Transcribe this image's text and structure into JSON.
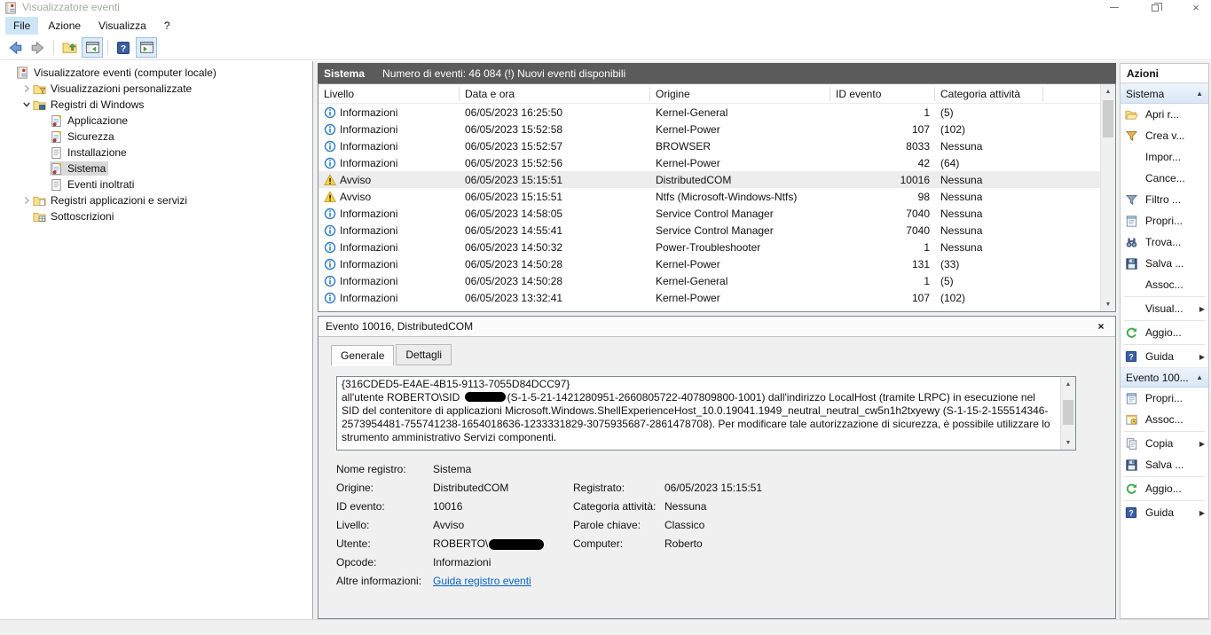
{
  "window": {
    "title": "Visualizzatore eventi"
  },
  "menu": {
    "items": [
      {
        "label": "File",
        "highlighted": true
      },
      {
        "label": "Azione",
        "highlighted": false
      },
      {
        "label": "Visualizza",
        "highlighted": false
      },
      {
        "label": "?",
        "highlighted": false
      }
    ]
  },
  "toolbar": {
    "buttons": [
      {
        "name": "back-button",
        "icon": "back-arrow",
        "toggled": false
      },
      {
        "name": "forward-button",
        "icon": "forward-arrow",
        "toggled": false
      },
      {
        "sep": true
      },
      {
        "name": "open-saved-log-button",
        "icon": "open-saved-log",
        "toggled": false
      },
      {
        "name": "show-console-tree-button",
        "icon": "console-tree-toggle",
        "toggled": true
      },
      {
        "sep": true
      },
      {
        "name": "help-button",
        "icon": "help-toolbar",
        "toggled": false
      },
      {
        "name": "show-action-pane-button",
        "icon": "action-pane-toggle",
        "toggled": true
      }
    ]
  },
  "tree": {
    "items": [
      {
        "label": "Visualizzatore eventi (computer locale)",
        "icon": "event-viewer",
        "indent": 0,
        "expander": "none",
        "selected": false
      },
      {
        "label": "Visualizzazioni personalizzate",
        "icon": "folder-filter",
        "indent": 1,
        "expander": "collapsed",
        "selected": false
      },
      {
        "label": "Registri di Windows",
        "icon": "folder-log",
        "indent": 1,
        "expander": "expanded",
        "selected": false
      },
      {
        "label": "Applicazione",
        "icon": "log",
        "indent": 2,
        "expander": "none",
        "selected": false
      },
      {
        "label": "Sicurezza",
        "icon": "log",
        "indent": 2,
        "expander": "none",
        "selected": false
      },
      {
        "label": "Installazione",
        "icon": "log-plain",
        "indent": 2,
        "expander": "none",
        "selected": false
      },
      {
        "label": "Sistema",
        "icon": "log",
        "indent": 2,
        "expander": "none",
        "selected": true
      },
      {
        "label": "Eventi inoltrati",
        "icon": "log-plain",
        "indent": 2,
        "expander": "none",
        "selected": false
      },
      {
        "label": "Registri applicazioni e servizi",
        "icon": "folder-apps",
        "indent": 1,
        "expander": "collapsed",
        "selected": false
      },
      {
        "label": "Sottoscrizioni",
        "icon": "folder-table",
        "indent": 1,
        "expander": "none",
        "selected": false
      }
    ]
  },
  "main": {
    "header": {
      "title": "Sistema",
      "subtitle": "Numero di eventi: 46 084 (!) Nuovi eventi disponibili"
    },
    "table": {
      "columns": [
        "Livello",
        "Data e ora",
        "Origine",
        "ID evento",
        "Categoria attività"
      ],
      "rows": [
        {
          "level": "Informazioni",
          "level_icon": "info",
          "datetime": "06/05/2023 16:25:50",
          "source": "Kernel-General",
          "event_id": "1",
          "category": "(5)",
          "selected": false
        },
        {
          "level": "Informazioni",
          "level_icon": "info",
          "datetime": "06/05/2023 15:52:58",
          "source": "Kernel-Power",
          "event_id": "107",
          "category": "(102)",
          "selected": false
        },
        {
          "level": "Informazioni",
          "level_icon": "info",
          "datetime": "06/05/2023 15:52:57",
          "source": "BROWSER",
          "event_id": "8033",
          "category": "Nessuna",
          "selected": false
        },
        {
          "level": "Informazioni",
          "level_icon": "info",
          "datetime": "06/05/2023 15:52:56",
          "source": "Kernel-Power",
          "event_id": "42",
          "category": "(64)",
          "selected": false
        },
        {
          "level": "Avviso",
          "level_icon": "warning",
          "datetime": "06/05/2023 15:15:51",
          "source": "DistributedCOM",
          "event_id": "10016",
          "category": "Nessuna",
          "selected": true
        },
        {
          "level": "Avviso",
          "level_icon": "warning",
          "datetime": "06/05/2023 15:15:51",
          "source": "Ntfs (Microsoft-Windows-Ntfs)",
          "event_id": "98",
          "category": "Nessuna",
          "selected": false
        },
        {
          "level": "Informazioni",
          "level_icon": "info",
          "datetime": "06/05/2023 14:58:05",
          "source": "Service Control Manager",
          "event_id": "7040",
          "category": "Nessuna",
          "selected": false
        },
        {
          "level": "Informazioni",
          "level_icon": "info",
          "datetime": "06/05/2023 14:55:41",
          "source": "Service Control Manager",
          "event_id": "7040",
          "category": "Nessuna",
          "selected": false
        },
        {
          "level": "Informazioni",
          "level_icon": "info",
          "datetime": "06/05/2023 14:50:32",
          "source": "Power-Troubleshooter",
          "event_id": "1",
          "category": "Nessuna",
          "selected": false
        },
        {
          "level": "Informazioni",
          "level_icon": "info",
          "datetime": "06/05/2023 14:50:28",
          "source": "Kernel-Power",
          "event_id": "131",
          "category": "(33)",
          "selected": false
        },
        {
          "level": "Informazioni",
          "level_icon": "info",
          "datetime": "06/05/2023 14:50:28",
          "source": "Kernel-General",
          "event_id": "1",
          "category": "(5)",
          "selected": false
        },
        {
          "level": "Informazioni",
          "level_icon": "info",
          "datetime": "06/05/2023 13:32:41",
          "source": "Kernel-Power",
          "event_id": "107",
          "category": "(102)",
          "selected": false
        }
      ]
    }
  },
  "detail": {
    "title": "Evento 10016, DistributedCOM",
    "tabs": [
      {
        "label": "Generale",
        "active": true
      },
      {
        "label": "Dettagli",
        "active": false
      }
    ],
    "message": {
      "line1": "{316CDED5-E4AE-4B15-9113-7055D84DCC97}",
      "part_before_redaction": " all'utente ROBERTO\\SID ",
      "part_after_redaction": "(S-1-5-21-1421280951-2660805722-407809800-1001) dall'indirizzo LocalHost (tramite LRPC) in esecuzione nel SID del contenitore di applicazioni Microsoft.Windows.ShellExperienceHost_10.0.19041.1949_neutral_neutral_cw5n1h2txyewy (S-1-15-2-155514346-2573954481-755741238-1654018636-1233331829-3075935687-2861478708). Per modificare tale autorizzazione di sicurezza, è possibile utilizzare lo strumento amministrativo Servizi componenti."
    },
    "fields_left": [
      {
        "label": "Nome registro:",
        "value": "Sistema",
        "type": "text"
      },
      {
        "label": "Origine:",
        "value": "DistributedCOM",
        "type": "text"
      },
      {
        "label": "ID evento:",
        "value": "10016",
        "type": "text"
      },
      {
        "label": "Livello:",
        "value": "Avviso",
        "type": "text"
      },
      {
        "label": "Utente:",
        "value": "ROBERTO\\",
        "type": "redacted"
      },
      {
        "label": "Opcode:",
        "value": "Informazioni",
        "type": "text"
      },
      {
        "label": "Altre informazioni:",
        "value": "Guida registro eventi",
        "type": "link"
      }
    ],
    "fields_right": [
      {
        "label": "Registrato:",
        "value": "06/05/2023 15:15:51",
        "row": 1
      },
      {
        "label": "Categoria attività:",
        "value": "Nessuna",
        "row": 2
      },
      {
        "label": "Parole chiave:",
        "value": "Classico",
        "row": 3
      },
      {
        "label": "Computer:",
        "value": "Roberto",
        "row": 4
      }
    ]
  },
  "actions": {
    "title": "Azioni",
    "sections": [
      {
        "header": "Sistema",
        "collapse_arrow": "▲",
        "items": [
          {
            "label": "Apri r...",
            "icon": "open-folder",
            "submenu": false
          },
          {
            "label": "Crea v...",
            "icon": "filter-create",
            "submenu": false
          },
          {
            "label": "Impor...",
            "icon": "none",
            "submenu": false
          },
          {
            "label": "Cance...",
            "icon": "none",
            "submenu": false
          },
          {
            "label": "Filtro ...",
            "icon": "filter",
            "submenu": false
          },
          {
            "label": "Propri...",
            "icon": "properties",
            "submenu": false
          },
          {
            "label": "Trova...",
            "icon": "find",
            "submenu": false
          },
          {
            "label": "Salva ...",
            "icon": "save",
            "submenu": false
          },
          {
            "label": "Assoc...",
            "icon": "none",
            "submenu": false
          },
          {
            "sep": true
          },
          {
            "label": "Visual...",
            "icon": "none",
            "submenu": true
          },
          {
            "sep": true
          },
          {
            "label": "Aggio...",
            "icon": "refresh",
            "submenu": false
          },
          {
            "sep": true
          },
          {
            "label": "Guida",
            "icon": "help",
            "submenu": true
          }
        ]
      },
      {
        "header": "Evento 100...",
        "collapse_arrow": "▲",
        "items": [
          {
            "label": "Propri...",
            "icon": "properties",
            "submenu": false
          },
          {
            "label": "Assoc...",
            "icon": "task",
            "submenu": false
          },
          {
            "sep": true
          },
          {
            "label": "Copia",
            "icon": "copy",
            "submenu": true
          },
          {
            "label": "Salva ...",
            "icon": "save",
            "submenu": false
          },
          {
            "sep": true
          },
          {
            "label": "Aggio...",
            "icon": "refresh",
            "submenu": false
          },
          {
            "sep": true
          },
          {
            "label": "Guida",
            "icon": "help",
            "submenu": true
          }
        ]
      }
    ]
  },
  "colors": {
    "main_header_bg": "#5b5b5b",
    "selection_gray": "#ededed",
    "tree_selection": "#d9d9d9",
    "link_blue": "#0563c1",
    "info_blue": "#2e7cc1",
    "warning_yellow": "#ffd43a",
    "action_section_bg_top": "#eef4fb",
    "action_section_bg_bottom": "#d8e6f6"
  }
}
